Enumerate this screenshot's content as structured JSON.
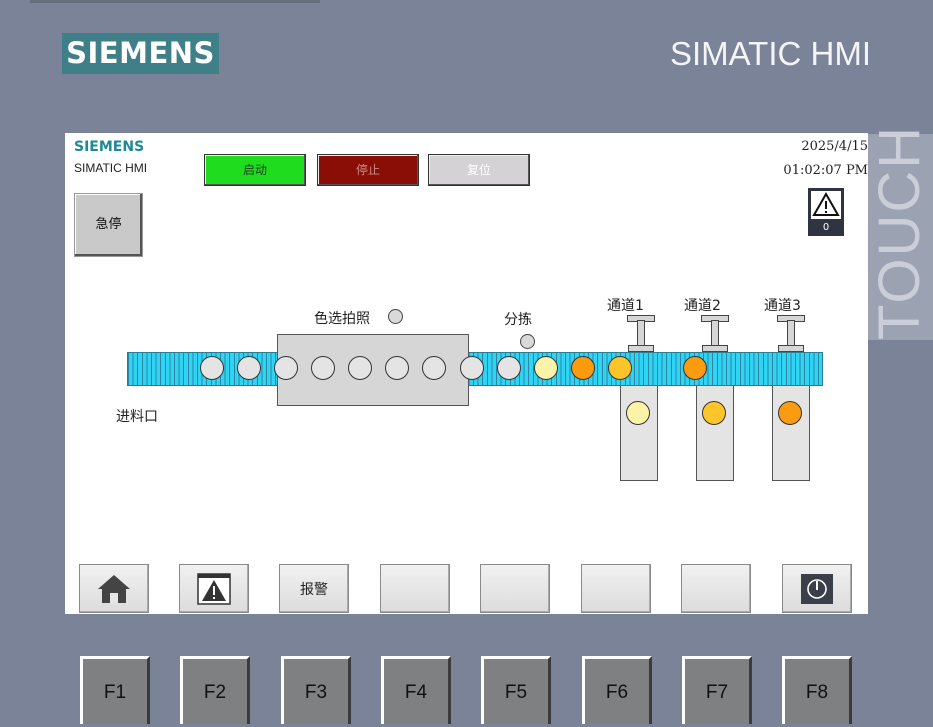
{
  "frame": {
    "brand": "SIEMENS",
    "product": "SIMATIC HMI",
    "touch_label": "TOUCH"
  },
  "screen": {
    "brand": "SIEMENS",
    "product": "SIMATIC HMI",
    "date": "2025/4/15",
    "time": "01:02:07 PM",
    "buttons": {
      "start": "启动",
      "stop": "停止",
      "reset": "复位",
      "estop": "急停"
    },
    "alarm_indicator": {
      "icon": "warning-icon",
      "count": "0"
    },
    "process": {
      "camera_label": "色选拍照",
      "sort_label": "分拣",
      "inlet_label": "进料口",
      "channels": [
        "通道1",
        "通道2",
        "通道3"
      ],
      "belt_balls": [
        "gray",
        "gray",
        "gray",
        "gray",
        "gray",
        "gray",
        "gray",
        "gray",
        "gray",
        "light-yellow",
        "orange",
        "yellow",
        "orange"
      ],
      "chute_balls": [
        "light-yellow",
        "yellow",
        "orange"
      ]
    },
    "nav": {
      "home_icon": "home-icon",
      "alarm_view_icon": "alarm-window-icon",
      "alarm_label": "报警",
      "power_icon": "power-icon"
    }
  },
  "function_keys": [
    "F1",
    "F2",
    "F3",
    "F4",
    "F5",
    "F6",
    "F7",
    "F8"
  ],
  "colors": {
    "frame": "#7a8397",
    "start": "#1fdc1f",
    "stop": "#8a0d06",
    "reset": "#d4d2d4",
    "conveyor": "#2fd3f4",
    "ball_gray": "#e4e4e4",
    "ball_light_yellow": "#fcf3a8",
    "ball_yellow": "#fdc52a",
    "ball_orange": "#fb9b0f"
  }
}
